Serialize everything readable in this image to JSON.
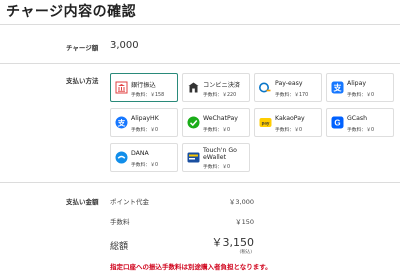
{
  "page": {
    "title": "チャージ内容の確認"
  },
  "charge": {
    "label": "チャージ額",
    "amount": "3,000"
  },
  "payment": {
    "label": "支払い方法",
    "methods": [
      {
        "name": "銀行振込",
        "fee": "手数料：￥158",
        "icon": "bank-icon",
        "selected": true
      },
      {
        "name": "コンビニ決済",
        "fee": "手数料：￥220",
        "icon": "convenience-store-icon",
        "selected": false
      },
      {
        "name": "Pay-easy",
        "fee": "手数料：￥170",
        "icon": "payeasy-icon",
        "selected": false
      },
      {
        "name": "Alipay",
        "fee": "手数料：￥0",
        "icon": "alipay-icon",
        "selected": false
      },
      {
        "name": "AlipayHK",
        "fee": "手数料：￥0",
        "icon": "alipayhk-icon",
        "selected": false
      },
      {
        "name": "WeChatPay",
        "fee": "手数料：￥0",
        "icon": "wechatpay-icon",
        "selected": false
      },
      {
        "name": "KakaoPay",
        "fee": "手数料：￥0",
        "icon": "kakaopay-icon",
        "selected": false
      },
      {
        "name": "GCash",
        "fee": "手数料：￥0",
        "icon": "gcash-icon",
        "selected": false
      },
      {
        "name": "DANA",
        "fee": "手数料：￥0",
        "icon": "dana-icon",
        "selected": false
      },
      {
        "name_line1": "Touch'n Go",
        "name_line2": "eWallet",
        "fee": "手数料：￥0",
        "icon": "touchngo-icon",
        "selected": false
      }
    ]
  },
  "summary": {
    "label": "支払い金額",
    "points_label": "ポイント代金",
    "points_value": "￥3,000",
    "fee_label": "手数料",
    "fee_value": "￥150",
    "total_label": "総額",
    "total_value": "￥3,150",
    "tax_note": "(税込)",
    "warning": "指定口座への振込手数料は別途購入者負担となります。"
  },
  "colors": {
    "selected_border": "#2a8a7a",
    "warning": "#d0021b",
    "alipay": "#1677ff",
    "wechat": "#1aad19",
    "kakao": "#ffcd00",
    "gcash": "#0061ff",
    "dana": "#118eea"
  }
}
